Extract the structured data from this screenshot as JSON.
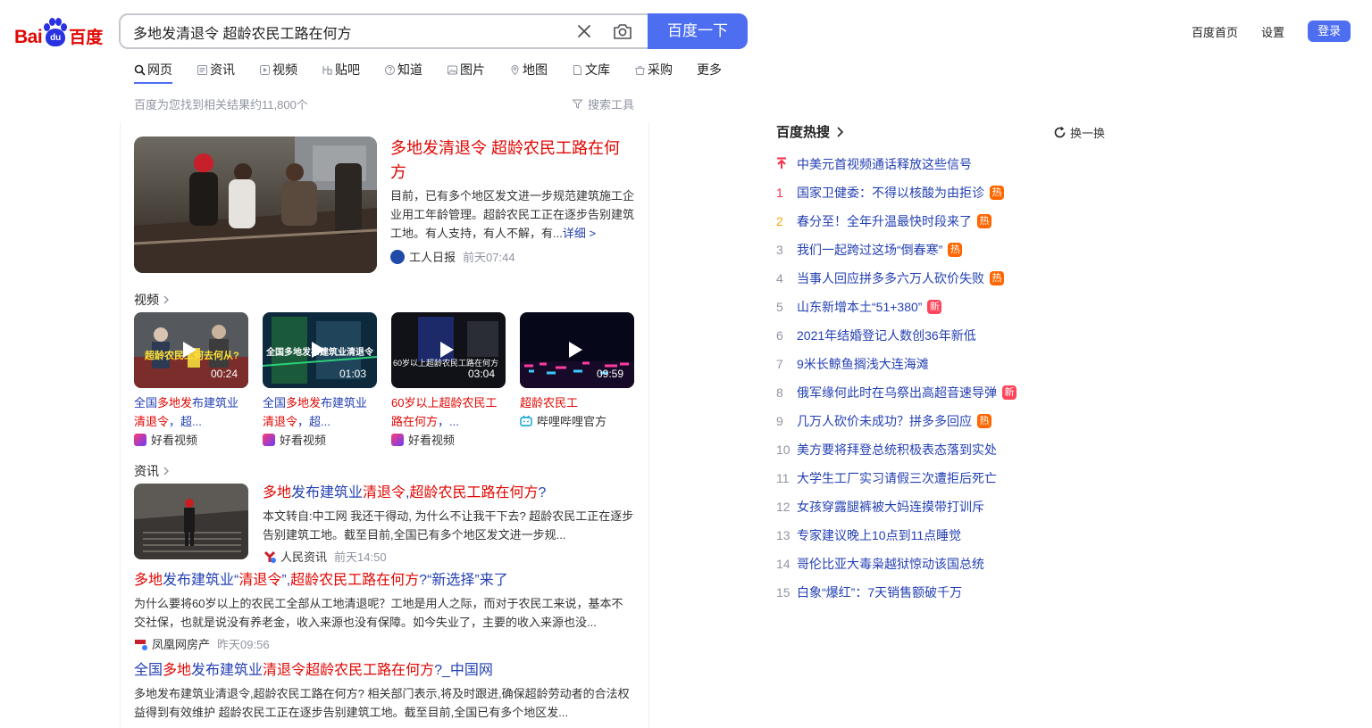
{
  "logo": {
    "bai": "Bai",
    "du_paw": "du",
    "du": "百度"
  },
  "search": {
    "query": "多地发清退令 超龄农民工路在何方",
    "button_label": "百度一下"
  },
  "top_links": [
    "百度首页",
    "设置"
  ],
  "login_label": "登录",
  "tabs": [
    {
      "label": "网页",
      "icon": "search-icon",
      "active": true
    },
    {
      "label": "资讯",
      "icon": "news-icon"
    },
    {
      "label": "视频",
      "icon": "video-icon"
    },
    {
      "label": "贴吧",
      "icon": "tieba-icon"
    },
    {
      "label": "知道",
      "icon": "question-icon"
    },
    {
      "label": "图片",
      "icon": "image-icon"
    },
    {
      "label": "地图",
      "icon": "map-icon"
    },
    {
      "label": "文库",
      "icon": "document-icon"
    },
    {
      "label": "采购",
      "icon": "shop-icon"
    },
    {
      "label": "更多"
    }
  ],
  "result_stat": "百度为您找到相关结果约11,800个",
  "search_tools": "搜索工具",
  "top_news": {
    "title": "多地发清退令 超龄农民工路在何方",
    "abstract": "目前，已有多个地区发文进一步规范建筑施工企业用工年龄管理。超龄农民工正在逐步告别建筑工地。有人支持，有人不解，有...",
    "more": "详细 >",
    "source": "工人日报",
    "time": "前天07:44"
  },
  "video_section_label": "视频",
  "videos": [
    {
      "title_parts": [
        "全国",
        "多地发",
        "布建筑业",
        "清退令",
        "，超..."
      ],
      "duration": "00:24",
      "source": "好看视频",
      "thumb_text": "超龄农民工何去何从?"
    },
    {
      "title_parts": [
        "全国",
        "多地发",
        "布建筑业",
        "清退令",
        "，超..."
      ],
      "duration": "01:03",
      "source": "好看视频",
      "thumb_text": "全国多地发布建筑业清退令"
    },
    {
      "title_parts": [
        "60岁以上",
        "超龄农民工",
        "",
        "路在何方",
        "，..."
      ],
      "duration": "03:04",
      "source": "好看视频",
      "thumb_text": "60岁以上超龄农民工路在何方"
    },
    {
      "title_parts": [
        "",
        "超龄农民工",
        "",
        "",
        ""
      ],
      "duration": "09:59",
      "source": "哔哩哔哩官方",
      "thumb_text": ""
    }
  ],
  "news_section_label": "资讯",
  "news": [
    {
      "title_parts": [
        "多地",
        "发布建筑业",
        "清退令",
        ",",
        "超龄农民工路在何方",
        "?"
      ],
      "abstract": "本文转自:中工网 我还干得动, 为什么不让我干下去? 超龄农民工正在逐步告别建筑工地。截至目前,全国已有多个地区发文进一步规...",
      "source": "人民资讯",
      "time": "前天14:50"
    },
    {
      "title_parts": [
        "多地",
        "发布建筑业“",
        "清退令",
        "”,",
        "超龄农民工路在何方",
        "?“新选择”来了"
      ],
      "abstract": "为什么要将60岁以上的农民工全部从工地清退呢？工地是用人之际，而对于农民工来说，基本不交社保，也就是说没有养老金，收入来源也没有保障。如今失业了，主要的收入来源也没...",
      "source": "凤凰网房产",
      "time": "昨天09:56"
    },
    {
      "title_parts": [
        "全国",
        "多地",
        "发布建筑业",
        "清退令",
        "超龄农民工路在何方",
        "?_中国网"
      ],
      "abstract": "多地发布建筑业清退令,超龄农民工路在何方? 相关部门表示,将及时跟进,确保超龄劳动者的合法权益得到有效维护 超龄农民工正在逐步告别建筑工地。截至目前,全国已有多个地区发..."
    }
  ],
  "hot": {
    "title": "百度热搜",
    "refresh": "换一换",
    "items": [
      {
        "rank": "",
        "text": "中美元首视频通话释放这些信号",
        "badge": "",
        "top": true
      },
      {
        "rank": "1",
        "text": "国家卫健委：不得以核酸为由拒诊",
        "badge": "热"
      },
      {
        "rank": "2",
        "text": "春分至！全年升温最快时段来了",
        "badge": "热"
      },
      {
        "rank": "3",
        "text": "我们一起跨过这场“倒春寒”",
        "badge": "热"
      },
      {
        "rank": "4",
        "text": "当事人回应拼多多六万人砍价失败",
        "badge": "热"
      },
      {
        "rank": "5",
        "text": "山东新增本土“51+380”",
        "badge": "新"
      },
      {
        "rank": "6",
        "text": "2021年结婚登记人数创36年新低",
        "badge": ""
      },
      {
        "rank": "7",
        "text": "9米长鲸鱼搁浅大连海滩",
        "badge": ""
      },
      {
        "rank": "8",
        "text": "俄军缘何此时在乌祭出高超音速导弹",
        "badge": "新"
      },
      {
        "rank": "9",
        "text": "几万人砍价未成功？拼多多回应",
        "badge": "热"
      },
      {
        "rank": "10",
        "text": "美方要将拜登总统积极表态落到实处",
        "badge": ""
      },
      {
        "rank": "11",
        "text": "大学生工厂实习请假三次遭拒后死亡",
        "badge": ""
      },
      {
        "rank": "12",
        "text": "女孩穿露腿裤被大妈连摸带打训斥",
        "badge": ""
      },
      {
        "rank": "13",
        "text": "专家建议晚上10点到11点睡觉",
        "badge": ""
      },
      {
        "rank": "14",
        "text": "哥伦比亚大毒枭越狱惊动该国总统",
        "badge": ""
      },
      {
        "rank": "15",
        "text": "白象“爆红”：7天销售额破千万",
        "badge": ""
      }
    ]
  }
}
